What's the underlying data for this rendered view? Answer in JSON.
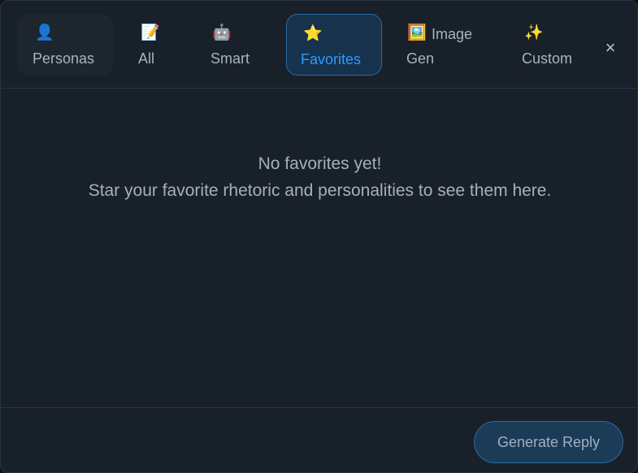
{
  "tabs": [
    {
      "icon": "person-icon",
      "emoji": "👤",
      "label": "Personas"
    },
    {
      "icon": "pencil-memo-icon",
      "emoji": "📝",
      "label": "All"
    },
    {
      "icon": "robot-icon",
      "emoji": "🤖",
      "label": "Smart"
    },
    {
      "icon": "star-icon",
      "emoji": "⭐",
      "label": "Favorites",
      "active": true
    },
    {
      "icon": "picture-icon",
      "emoji": "🖼️",
      "label_line1": "Image",
      "label_line2": "Gen"
    },
    {
      "icon": "sparkles-icon",
      "emoji": "✨",
      "label": "Custom"
    }
  ],
  "close_label": "×",
  "empty_state": {
    "title": "No favorites yet!",
    "message": "Star your favorite rhetoric and personalities to see them here."
  },
  "footer": {
    "generate_label": "Generate Reply"
  },
  "colors": {
    "accent": "#2f9bff",
    "panel_bg": "#18202a",
    "active_tab_bg": "#17324d"
  }
}
